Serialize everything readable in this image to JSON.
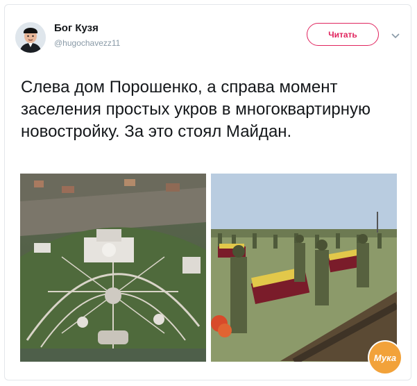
{
  "tweet": {
    "author_name": "Бог Кузя",
    "author_handle": "@hugochavezz11",
    "follow_label": "Читать",
    "text": "Слева дом Порошенко, а справа момент заселения простых укров в многоквартирную новостройку. За это стоял Майдан.",
    "watermark": "Мука"
  },
  "icons": {
    "menu": "chevron-down-icon"
  },
  "colors": {
    "accent": "#e0245e",
    "text": "#14171a",
    "secondary": "#8899a6"
  }
}
